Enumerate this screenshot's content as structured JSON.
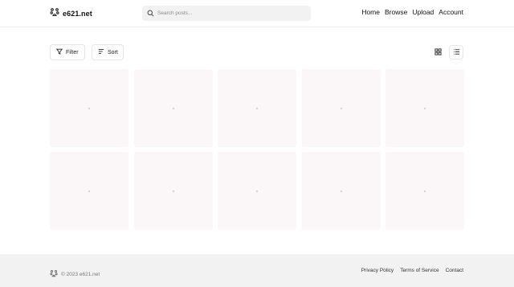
{
  "header": {
    "logo_text": "e621.net",
    "search_placeholder": "Search posts...",
    "nav": [
      {
        "label": "Home"
      },
      {
        "label": "Browse"
      },
      {
        "label": "Upload"
      },
      {
        "label": "Account"
      }
    ]
  },
  "toolbar": {
    "filter_label": "Filter",
    "sort_label": "Sort",
    "active_view": "list"
  },
  "grid": {
    "tile_count": 10,
    "columns": 5
  },
  "footer": {
    "copyright": "© 2023 e621.net",
    "links": [
      {
        "label": "Privacy Policy"
      },
      {
        "label": "Terms of Service"
      },
      {
        "label": "Contact"
      }
    ]
  },
  "colors": {
    "tile_bg": "#fbf6f7",
    "footer_bg": "#f2f2f2",
    "search_bg": "#f2f2f2"
  }
}
